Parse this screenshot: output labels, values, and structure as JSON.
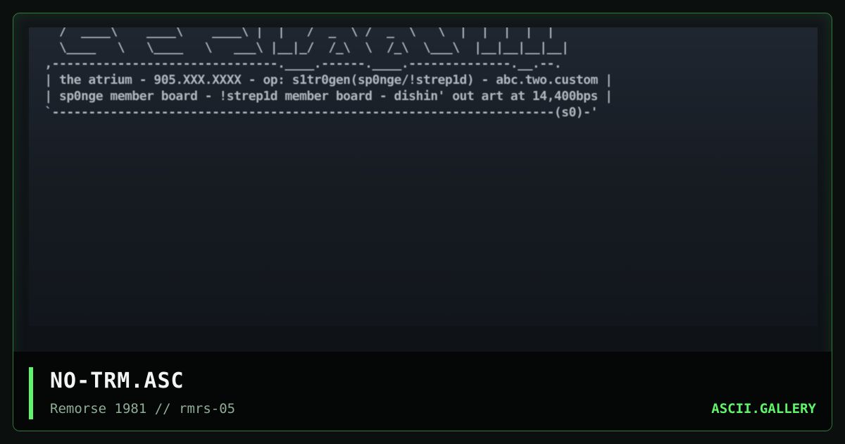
{
  "artwork": {
    "ascii_lines": [
      "   /  ____\\    ____\\    ____\\ |  |   /  _  \\ /  _  \\   \\  |  |  |  |  |",
      "   \\____   \\   \\____   \\   ___\\ |__|_/  /_\\  \\  /_\\  \\___\\  |__|__|__|__|",
      " ,-------------------------------.____.------.____.--------------.__.--.",
      " | the atrium - 905.XXX.XXXX - op: s1tr0gen(sp0nge/!strep1d) - abc.two.custom |",
      " | sp0nge member board - !strep1d member board - dishin' out art at 14,400bps |",
      " `---------------------------------------------------------------------(s0)-'"
    ]
  },
  "footer": {
    "title": "NO-TRM.ASC",
    "subtitle": "Remorse 1981 // rmrs-05",
    "brand": "ASCII.GALLERY"
  },
  "colors": {
    "accent": "#5ff56a",
    "border": "#2f7a39",
    "art_text": "#c9d1d9"
  }
}
